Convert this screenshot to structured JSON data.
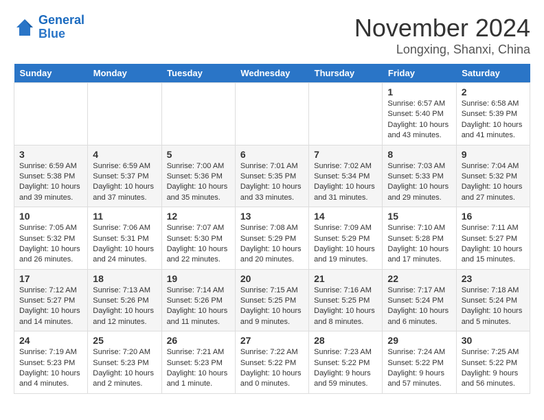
{
  "logo": {
    "text_general": "General",
    "text_blue": "Blue"
  },
  "title": "November 2024",
  "location": "Longxing, Shanxi, China",
  "weekdays": [
    "Sunday",
    "Monday",
    "Tuesday",
    "Wednesday",
    "Thursday",
    "Friday",
    "Saturday"
  ],
  "rows": [
    [
      {
        "day": "",
        "text": ""
      },
      {
        "day": "",
        "text": ""
      },
      {
        "day": "",
        "text": ""
      },
      {
        "day": "",
        "text": ""
      },
      {
        "day": "",
        "text": ""
      },
      {
        "day": "1",
        "text": "Sunrise: 6:57 AM\nSunset: 5:40 PM\nDaylight: 10 hours and 43 minutes."
      },
      {
        "day": "2",
        "text": "Sunrise: 6:58 AM\nSunset: 5:39 PM\nDaylight: 10 hours and 41 minutes."
      }
    ],
    [
      {
        "day": "3",
        "text": "Sunrise: 6:59 AM\nSunset: 5:38 PM\nDaylight: 10 hours and 39 minutes."
      },
      {
        "day": "4",
        "text": "Sunrise: 6:59 AM\nSunset: 5:37 PM\nDaylight: 10 hours and 37 minutes."
      },
      {
        "day": "5",
        "text": "Sunrise: 7:00 AM\nSunset: 5:36 PM\nDaylight: 10 hours and 35 minutes."
      },
      {
        "day": "6",
        "text": "Sunrise: 7:01 AM\nSunset: 5:35 PM\nDaylight: 10 hours and 33 minutes."
      },
      {
        "day": "7",
        "text": "Sunrise: 7:02 AM\nSunset: 5:34 PM\nDaylight: 10 hours and 31 minutes."
      },
      {
        "day": "8",
        "text": "Sunrise: 7:03 AM\nSunset: 5:33 PM\nDaylight: 10 hours and 29 minutes."
      },
      {
        "day": "9",
        "text": "Sunrise: 7:04 AM\nSunset: 5:32 PM\nDaylight: 10 hours and 27 minutes."
      }
    ],
    [
      {
        "day": "10",
        "text": "Sunrise: 7:05 AM\nSunset: 5:32 PM\nDaylight: 10 hours and 26 minutes."
      },
      {
        "day": "11",
        "text": "Sunrise: 7:06 AM\nSunset: 5:31 PM\nDaylight: 10 hours and 24 minutes."
      },
      {
        "day": "12",
        "text": "Sunrise: 7:07 AM\nSunset: 5:30 PM\nDaylight: 10 hours and 22 minutes."
      },
      {
        "day": "13",
        "text": "Sunrise: 7:08 AM\nSunset: 5:29 PM\nDaylight: 10 hours and 20 minutes."
      },
      {
        "day": "14",
        "text": "Sunrise: 7:09 AM\nSunset: 5:29 PM\nDaylight: 10 hours and 19 minutes."
      },
      {
        "day": "15",
        "text": "Sunrise: 7:10 AM\nSunset: 5:28 PM\nDaylight: 10 hours and 17 minutes."
      },
      {
        "day": "16",
        "text": "Sunrise: 7:11 AM\nSunset: 5:27 PM\nDaylight: 10 hours and 15 minutes."
      }
    ],
    [
      {
        "day": "17",
        "text": "Sunrise: 7:12 AM\nSunset: 5:27 PM\nDaylight: 10 hours and 14 minutes."
      },
      {
        "day": "18",
        "text": "Sunrise: 7:13 AM\nSunset: 5:26 PM\nDaylight: 10 hours and 12 minutes."
      },
      {
        "day": "19",
        "text": "Sunrise: 7:14 AM\nSunset: 5:26 PM\nDaylight: 10 hours and 11 minutes."
      },
      {
        "day": "20",
        "text": "Sunrise: 7:15 AM\nSunset: 5:25 PM\nDaylight: 10 hours and 9 minutes."
      },
      {
        "day": "21",
        "text": "Sunrise: 7:16 AM\nSunset: 5:25 PM\nDaylight: 10 hours and 8 minutes."
      },
      {
        "day": "22",
        "text": "Sunrise: 7:17 AM\nSunset: 5:24 PM\nDaylight: 10 hours and 6 minutes."
      },
      {
        "day": "23",
        "text": "Sunrise: 7:18 AM\nSunset: 5:24 PM\nDaylight: 10 hours and 5 minutes."
      }
    ],
    [
      {
        "day": "24",
        "text": "Sunrise: 7:19 AM\nSunset: 5:23 PM\nDaylight: 10 hours and 4 minutes."
      },
      {
        "day": "25",
        "text": "Sunrise: 7:20 AM\nSunset: 5:23 PM\nDaylight: 10 hours and 2 minutes."
      },
      {
        "day": "26",
        "text": "Sunrise: 7:21 AM\nSunset: 5:23 PM\nDaylight: 10 hours and 1 minute."
      },
      {
        "day": "27",
        "text": "Sunrise: 7:22 AM\nSunset: 5:22 PM\nDaylight: 10 hours and 0 minutes."
      },
      {
        "day": "28",
        "text": "Sunrise: 7:23 AM\nSunset: 5:22 PM\nDaylight: 9 hours and 59 minutes."
      },
      {
        "day": "29",
        "text": "Sunrise: 7:24 AM\nSunset: 5:22 PM\nDaylight: 9 hours and 57 minutes."
      },
      {
        "day": "30",
        "text": "Sunrise: 7:25 AM\nSunset: 5:22 PM\nDaylight: 9 hours and 56 minutes."
      }
    ]
  ]
}
